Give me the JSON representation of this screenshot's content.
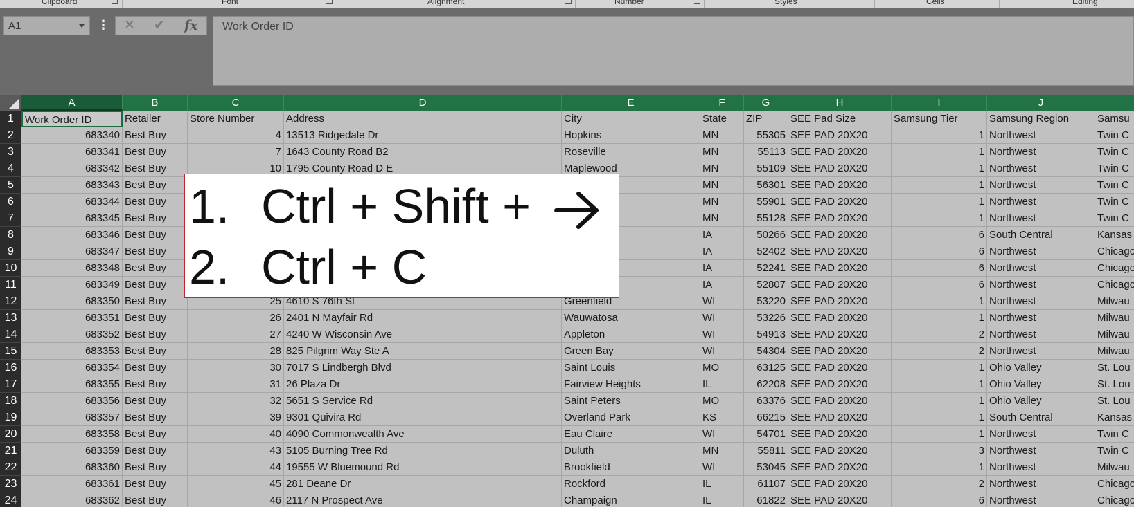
{
  "ribbon": {
    "groups": [
      "Clipboard",
      "Font",
      "Alignment",
      "Number",
      "Styles",
      "Cells",
      "Editing"
    ]
  },
  "formula_bar": {
    "name_box": "A1",
    "more_label": "⋮",
    "cancel_label": "✕",
    "enter_label": "✔",
    "fx_label": "fx",
    "content": "Work Order ID"
  },
  "columns": [
    "A",
    "B",
    "C",
    "D",
    "E",
    "F",
    "G",
    "H",
    "I",
    "J",
    ""
  ],
  "rows": [
    "1",
    "2",
    "3",
    "4",
    "5",
    "6",
    "7",
    "8",
    "9",
    "10",
    "11",
    "12",
    "13",
    "14",
    "15",
    "16",
    "17",
    "18",
    "19",
    "20",
    "21",
    "22",
    "23",
    "24"
  ],
  "sheet": {
    "header": [
      "Work Order ID",
      "Retailer",
      "Store Number",
      "Address",
      "City",
      "State",
      "ZIP",
      "SEE Pad Size",
      "Samsung Tier",
      "Samsung Region",
      "Samsu"
    ],
    "data": [
      [
        "683340",
        "Best Buy",
        "4",
        "13513 Ridgedale Dr",
        "Hopkins",
        "MN",
        "55305",
        "SEE PAD 20X20",
        "1",
        "Northwest",
        "Twin C"
      ],
      [
        "683341",
        "Best Buy",
        "7",
        "1643 County Road B2",
        "Roseville",
        "MN",
        "55113",
        "SEE PAD 20X20",
        "1",
        "Northwest",
        "Twin C"
      ],
      [
        "683342",
        "Best Buy",
        "10",
        "1795 County Road D E",
        "Maplewood",
        "MN",
        "55109",
        "SEE PAD 20X20",
        "1",
        "Northwest",
        "Twin C"
      ],
      [
        "683343",
        "Best Buy",
        "",
        "",
        "d",
        "MN",
        "56301",
        "SEE PAD 20X20",
        "1",
        "Northwest",
        "Twin C"
      ],
      [
        "683344",
        "Best Buy",
        "",
        "",
        "R",
        "MN",
        "55901",
        "SEE PAD 20X20",
        "1",
        "Northwest",
        "Twin C"
      ],
      [
        "683345",
        "Best Buy",
        "",
        "",
        "",
        "MN",
        "55128",
        "SEE PAD 20X20",
        "1",
        "Northwest",
        "Twin C"
      ],
      [
        "683346",
        "Best Buy",
        "",
        "",
        "Moines",
        "IA",
        "50266",
        "SEE PAD 20X20",
        "6",
        "South Central",
        "Kansas"
      ],
      [
        "683347",
        "Best Buy",
        "",
        "",
        "ids",
        "IA",
        "52402",
        "SEE PAD 20X20",
        "6",
        "Northwest",
        "Chicago"
      ],
      [
        "683348",
        "Best Buy",
        "",
        "",
        "",
        "IA",
        "52241",
        "SEE PAD 20X20",
        "6",
        "Northwest",
        "Chicago"
      ],
      [
        "683349",
        "Best Buy",
        "",
        "",
        "",
        "IA",
        "52807",
        "SEE PAD 20X20",
        "6",
        "Northwest",
        "Chicago"
      ],
      [
        "683350",
        "Best Buy",
        "25",
        "4610 S 76th St",
        "Greenfield",
        "WI",
        "53220",
        "SEE PAD 20X20",
        "1",
        "Northwest",
        "Milwau"
      ],
      [
        "683351",
        "Best Buy",
        "26",
        "2401 N Mayfair Rd",
        "Wauwatosa",
        "WI",
        "53226",
        "SEE PAD 20X20",
        "1",
        "Northwest",
        "Milwau"
      ],
      [
        "683352",
        "Best Buy",
        "27",
        "4240 W Wisconsin Ave",
        "Appleton",
        "WI",
        "54913",
        "SEE PAD 20X20",
        "2",
        "Northwest",
        "Milwau"
      ],
      [
        "683353",
        "Best Buy",
        "28",
        "825 Pilgrim Way Ste A",
        "Green Bay",
        "WI",
        "54304",
        "SEE PAD 20X20",
        "2",
        "Northwest",
        "Milwau"
      ],
      [
        "683354",
        "Best Buy",
        "30",
        "7017 S Lindbergh Blvd",
        "Saint Louis",
        "MO",
        "63125",
        "SEE PAD 20X20",
        "1",
        "Ohio Valley",
        "St. Lou"
      ],
      [
        "683355",
        "Best Buy",
        "31",
        "26 Plaza Dr",
        "Fairview Heights",
        "IL",
        "62208",
        "SEE PAD 20X20",
        "1",
        "Ohio Valley",
        "St. Lou"
      ],
      [
        "683356",
        "Best Buy",
        "32",
        "5651 S Service Rd",
        "Saint Peters",
        "MO",
        "63376",
        "SEE PAD 20X20",
        "1",
        "Ohio Valley",
        "St. Lou"
      ],
      [
        "683357",
        "Best Buy",
        "39",
        "9301 Quivira Rd",
        "Overland Park",
        "KS",
        "66215",
        "SEE PAD 20X20",
        "1",
        "South Central",
        "Kansas"
      ],
      [
        "683358",
        "Best Buy",
        "40",
        "4090 Commonwealth Ave",
        "Eau Claire",
        "WI",
        "54701",
        "SEE PAD 20X20",
        "1",
        "Northwest",
        "Twin C"
      ],
      [
        "683359",
        "Best Buy",
        "43",
        "5105 Burning Tree Rd",
        "Duluth",
        "MN",
        "55811",
        "SEE PAD 20X20",
        "3",
        "Northwest",
        "Twin C"
      ],
      [
        "683360",
        "Best Buy",
        "44",
        "19555 W Bluemound Rd",
        "Brookfield",
        "WI",
        "53045",
        "SEE PAD 20X20",
        "1",
        "Northwest",
        "Milwau"
      ],
      [
        "683361",
        "Best Buy",
        "45",
        "281 Deane Dr",
        "Rockford",
        "IL",
        "61107",
        "SEE PAD 20X20",
        "2",
        "Northwest",
        "Chicago"
      ],
      [
        "683362",
        "Best Buy",
        "46",
        "2117 N Prospect Ave",
        "Champaign",
        "IL",
        "61822",
        "SEE PAD 20X20",
        "6",
        "Northwest",
        "Chicago"
      ]
    ]
  },
  "overlay": {
    "step1_num": "1.",
    "step1_text": "Ctrl + Shift + ",
    "step2_num": "2.",
    "step2_text": "Ctrl + C"
  },
  "colors": {
    "header_green": "#217346",
    "overlay_border": "#c0262d"
  }
}
